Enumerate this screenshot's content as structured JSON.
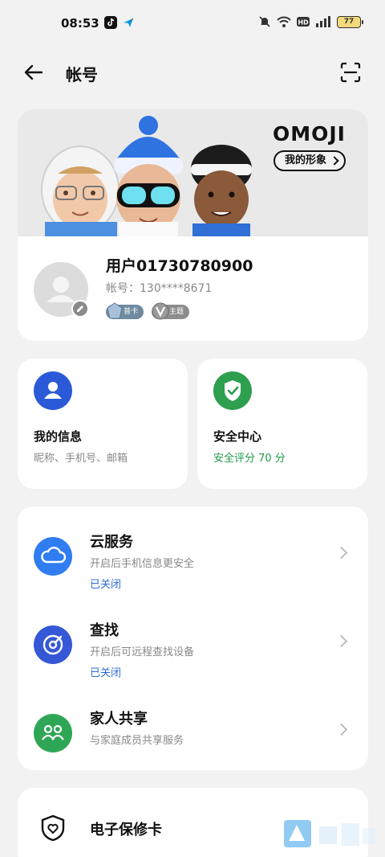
{
  "status_bar": {
    "time": "08:53",
    "battery": "77",
    "icons": [
      "tiktok-icon",
      "plane-app-icon",
      "mute-icon",
      "wifi-icon",
      "hd-icon",
      "signal-icon",
      "battery-icon"
    ]
  },
  "header": {
    "title": "帐号",
    "back_icon": "arrow-left-icon",
    "scan_icon": "scan-icon"
  },
  "omoji": {
    "logo": "OMOJI",
    "button_label": "我的形象"
  },
  "profile": {
    "name": "用户01730780900",
    "account": "帐号：130****8671",
    "badges": [
      {
        "label": "普卡",
        "icon": "card-badge-icon"
      },
      {
        "label": "主题",
        "icon": "v-theme-icon"
      }
    ]
  },
  "my_info": {
    "title": "我的信息",
    "subtitle": "昵称、手机号、邮箱",
    "color": "#2b5ad8"
  },
  "security": {
    "title": "安全中心",
    "subtitle": "安全评分 70 分",
    "color": "#2e9e4f"
  },
  "services": [
    {
      "title": "云服务",
      "subtitle": "开启后手机信息更安全",
      "status": "已关闭",
      "icon": "cloud-icon",
      "color": "#2f7df0"
    },
    {
      "title": "查找",
      "subtitle": "开启后可远程查找设备",
      "status": "已关闭",
      "icon": "find-radar-icon",
      "color": "#3558d6"
    },
    {
      "title": "家人共享",
      "subtitle": "与家庭成员共享服务",
      "status": "",
      "icon": "family-icon",
      "color": "#2fa656"
    }
  ],
  "warranty": {
    "title": "电子保修卡",
    "icon": "shield-heart-icon"
  },
  "colors": {
    "link_blue": "#2f6bd8",
    "security_green": "#1e9b4a",
    "background": "#f2f2f2"
  }
}
